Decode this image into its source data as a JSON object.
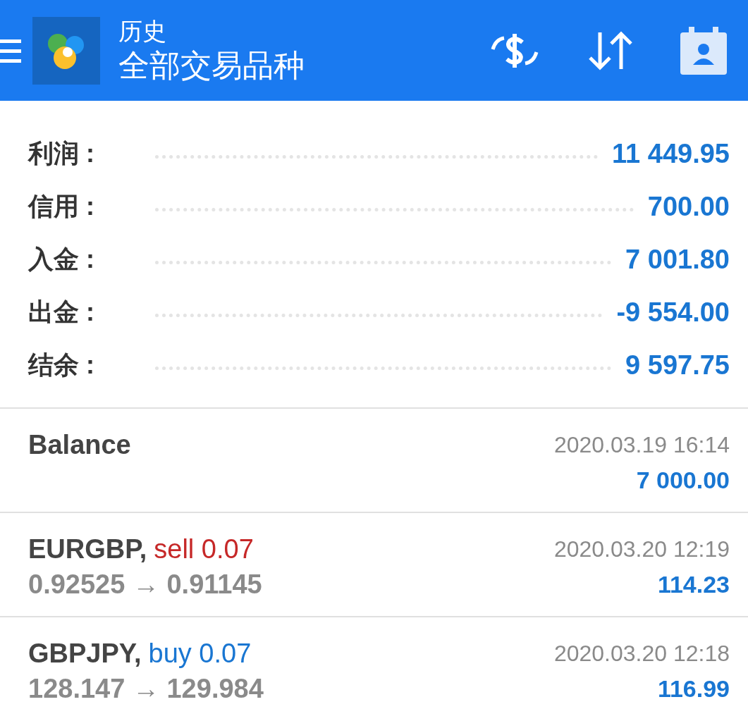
{
  "header": {
    "title": "历史",
    "subtitle": "全部交易品种"
  },
  "summary": [
    {
      "label": "利润 :",
      "value": "11 449.95"
    },
    {
      "label": "信用 :",
      "value": "700.00"
    },
    {
      "label": "入金 :",
      "value": "7 001.80"
    },
    {
      "label": "出金 :",
      "value": "-9 554.00"
    },
    {
      "label": "结余 :",
      "value": "9 597.75"
    }
  ],
  "deals": [
    {
      "kind": "balance",
      "title": "Balance",
      "time": "2020.03.19 16:14",
      "amount": "7 000.00"
    },
    {
      "kind": "trade",
      "symbol": "EURGBP,",
      "action": "sell 0.07",
      "color": "#c62828",
      "prices": "0.92525 → 0.91145",
      "time": "2020.03.20 12:19",
      "amount": "114.23"
    },
    {
      "kind": "trade",
      "symbol": "GBPJPY,",
      "action": "buy 0.07",
      "color": "#1976d2",
      "prices": "128.147 → 129.984",
      "time": "2020.03.20 12:18",
      "amount": "116.99"
    }
  ]
}
